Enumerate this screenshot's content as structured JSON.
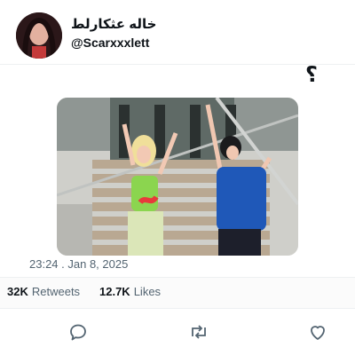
{
  "author": {
    "display_name": "خاله عثكارلط",
    "handle": "@Scarxxxlett"
  },
  "tweet": {
    "text": "؟",
    "timestamp": "23:24  .  Jan 8, 2025"
  },
  "stats": {
    "retweets_count": "32K",
    "retweets_label": "Retweets",
    "likes_count": "12.7K",
    "likes_label": "Likes"
  },
  "icons": {
    "reply": "reply-icon",
    "retweet": "retweet-icon",
    "like": "heart-icon"
  },
  "colors": {
    "text": "#0f1419",
    "secondary": "#536471",
    "icon": "#536471"
  }
}
